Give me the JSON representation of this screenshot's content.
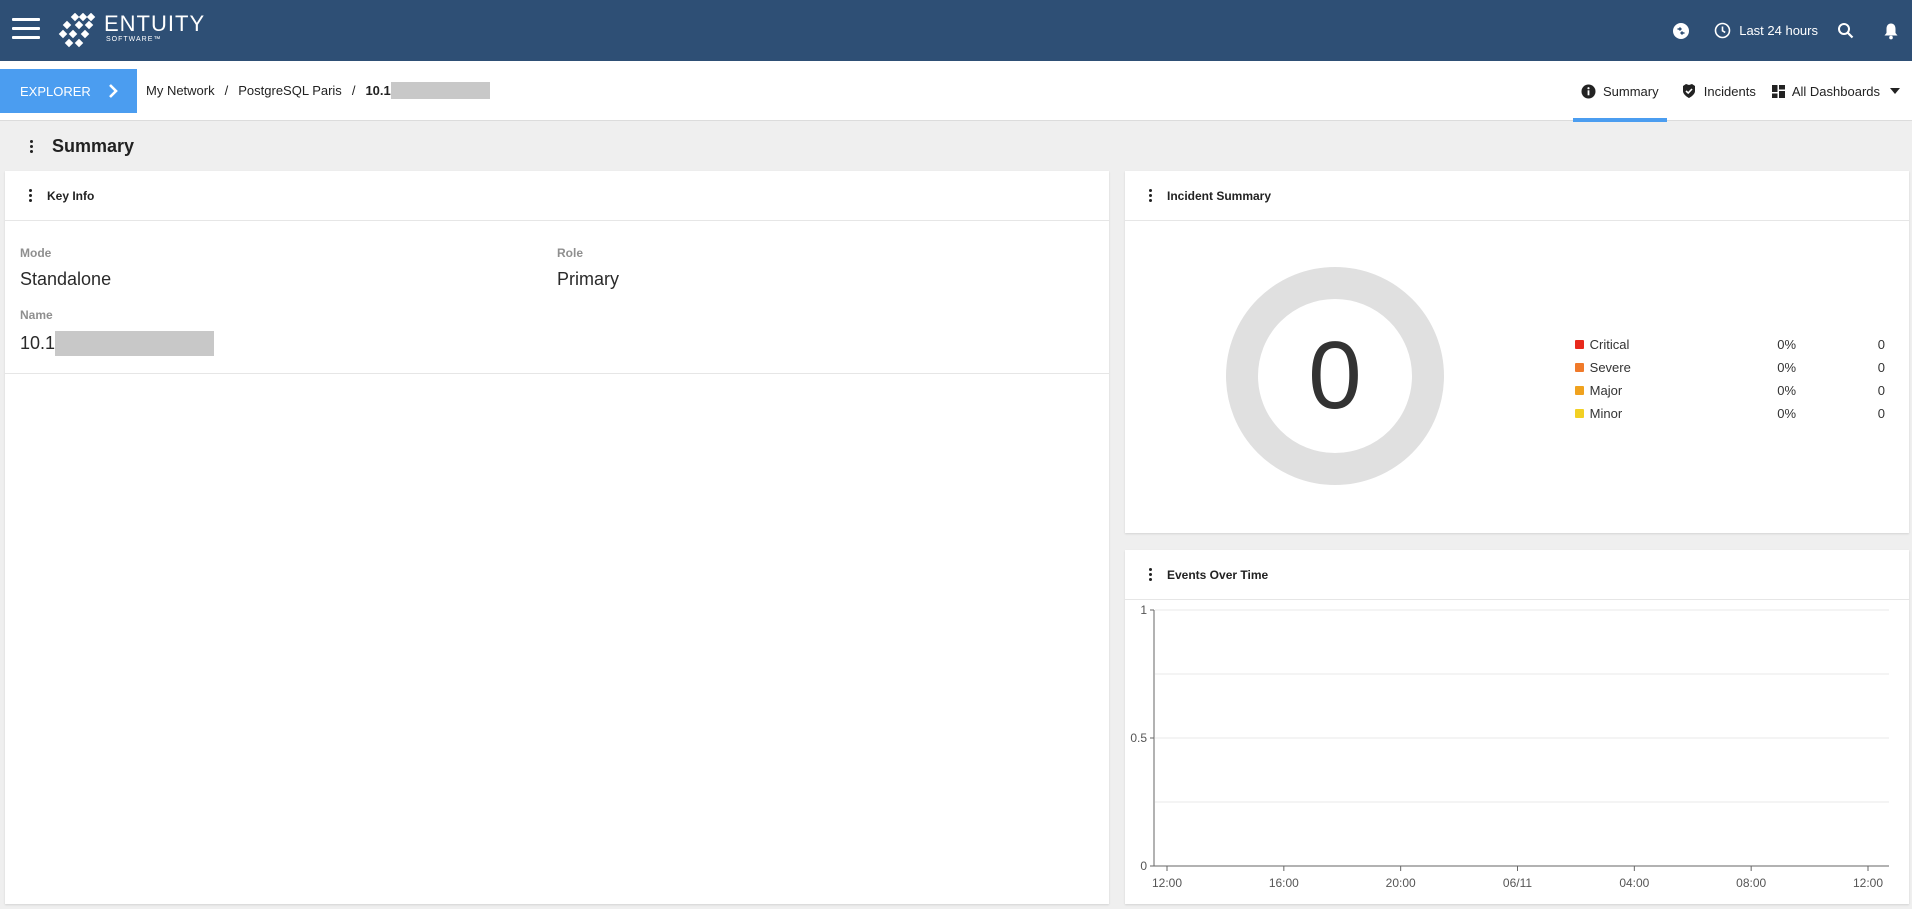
{
  "app": {
    "logo_name": "ENTUITY",
    "logo_sub": "SOFTWARE™"
  },
  "topbar": {
    "time_range_label": "Last 24 hours",
    "icons": [
      "menu-icon",
      "user-switch-icon",
      "clock-icon",
      "search-icon",
      "bell-icon"
    ]
  },
  "explorer": {
    "label": "EXPLORER"
  },
  "breadcrumb": {
    "items": [
      "My Network",
      "PostgreSQL Paris"
    ],
    "separator": "/",
    "current_prefix": "10.1"
  },
  "tabs": [
    {
      "label": "Summary",
      "icon": "info-icon",
      "active": true
    },
    {
      "label": "Incidents",
      "icon": "incident-shield-icon",
      "active": false
    },
    {
      "label": "All Dashboards",
      "icon": "dashboard-grid-icon",
      "active": false
    }
  ],
  "page": {
    "title": "Summary"
  },
  "key_info": {
    "title": "Key Info",
    "mode_label": "Mode",
    "mode_value": "Standalone",
    "role_label": "Role",
    "role_value": "Primary",
    "name_label": "Name",
    "name_value_prefix": "10.1"
  },
  "incident_summary": {
    "title": "Incident Summary",
    "total": "0",
    "legend": [
      {
        "name": "Critical",
        "pct": "0%",
        "count": "0",
        "color": "#e8291c"
      },
      {
        "name": "Severe",
        "pct": "0%",
        "count": "0",
        "color": "#f07a2a"
      },
      {
        "name": "Major",
        "pct": "0%",
        "count": "0",
        "color": "#f0a21e"
      },
      {
        "name": "Minor",
        "pct": "0%",
        "count": "0",
        "color": "#f2d024"
      }
    ]
  },
  "events_over_time": {
    "title": "Events Over Time"
  },
  "chart_data": {
    "type": "line",
    "title": "Events Over Time",
    "x": [
      "12:00",
      "16:00",
      "20:00",
      "06/11",
      "04:00",
      "08:00",
      "12:00"
    ],
    "y_ticks": [
      "0",
      "0.5",
      "1"
    ],
    "ylim": [
      0,
      1
    ],
    "series": [],
    "grid": true
  },
  "colors": {
    "topbar": "#2e4f75",
    "accent": "#4b9df0",
    "donut_ring": "#e0e0e0"
  }
}
